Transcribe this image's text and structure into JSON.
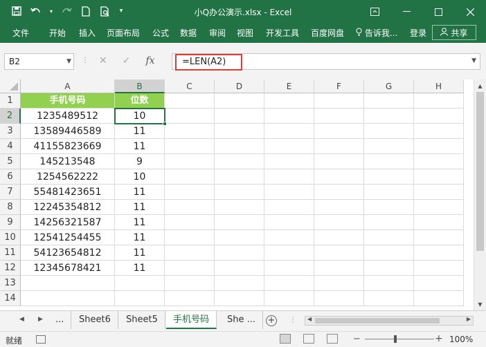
{
  "window": {
    "title": "小Q办公演示.xlsx - Excel"
  },
  "ribbon_tabs": [
    "文件",
    "开始",
    "插入",
    "页面布局",
    "公式",
    "数据",
    "审阅",
    "视图",
    "开发工具",
    "百度网盘",
    "告诉我...",
    "登录",
    "共享"
  ],
  "formula_bar": {
    "name_box": "B2",
    "formula": "=LEN(A2)"
  },
  "columns": [
    "A",
    "B",
    "C",
    "D",
    "E",
    "F",
    "G",
    "H"
  ],
  "rows": [
    "1",
    "2",
    "3",
    "4",
    "5",
    "6",
    "7",
    "8",
    "9",
    "10",
    "11",
    "12",
    "13",
    "14"
  ],
  "sheet": {
    "header": [
      "手机号码",
      "位数"
    ],
    "data": [
      [
        "1235489512",
        "10"
      ],
      [
        "13589446589",
        "11"
      ],
      [
        "41155823669",
        "11"
      ],
      [
        "145213548",
        "9"
      ],
      [
        "1254562222",
        "10"
      ],
      [
        "55481423651",
        "11"
      ],
      [
        "12245354812",
        "11"
      ],
      [
        "14256321587",
        "11"
      ],
      [
        "12541254455",
        "11"
      ],
      [
        "54123654812",
        "11"
      ],
      [
        "12345678421",
        "11"
      ]
    ]
  },
  "sheet_tabs": {
    "ellipsis": "...",
    "tabs": [
      "Sheet6",
      "Sheet5",
      "手机号码",
      "She ..."
    ],
    "active": "手机号码"
  },
  "status_bar": {
    "status": "就绪",
    "zoom": "100%"
  },
  "colors": {
    "accent": "#217346",
    "header_fill": "#92d050",
    "highlight_border": "#e03a3a"
  }
}
